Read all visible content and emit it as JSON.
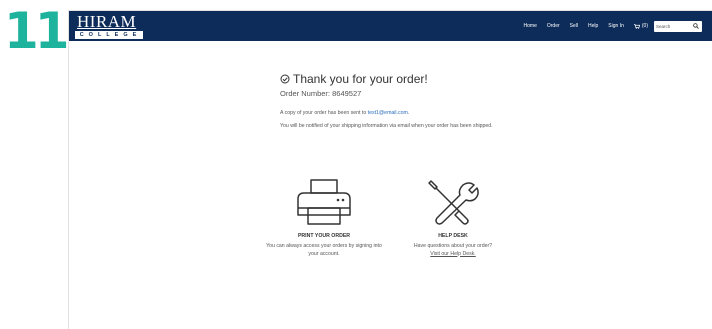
{
  "step": "11",
  "logo": {
    "word": "HIRAM",
    "sub": "COLLEGE"
  },
  "nav": {
    "items": [
      "Home",
      "Order",
      "Sell",
      "Help",
      "Sign In"
    ],
    "cart_label": "(0)",
    "search_placeholder": "Search"
  },
  "confirmation": {
    "title": "Thank you for your order!",
    "order_number": "Order Number: 8649527",
    "copy_prefix": "A copy of your order has been sent to ",
    "email": "test1@email.com",
    "copy_suffix": ".",
    "notify": "You will be notified of your shipping information via email when your order has been shipped."
  },
  "cards": {
    "print": {
      "title": "PRINT YOUR ORDER",
      "text": "You can always access your orders by signing into your account."
    },
    "help": {
      "title": "HELP DESK",
      "text": "Have questions about your order?",
      "link": "Visit our Help Desk."
    }
  },
  "colors": {
    "navbar": "#0e2c5a",
    "step_number": "#1db39c",
    "link": "#2a6ebb"
  }
}
